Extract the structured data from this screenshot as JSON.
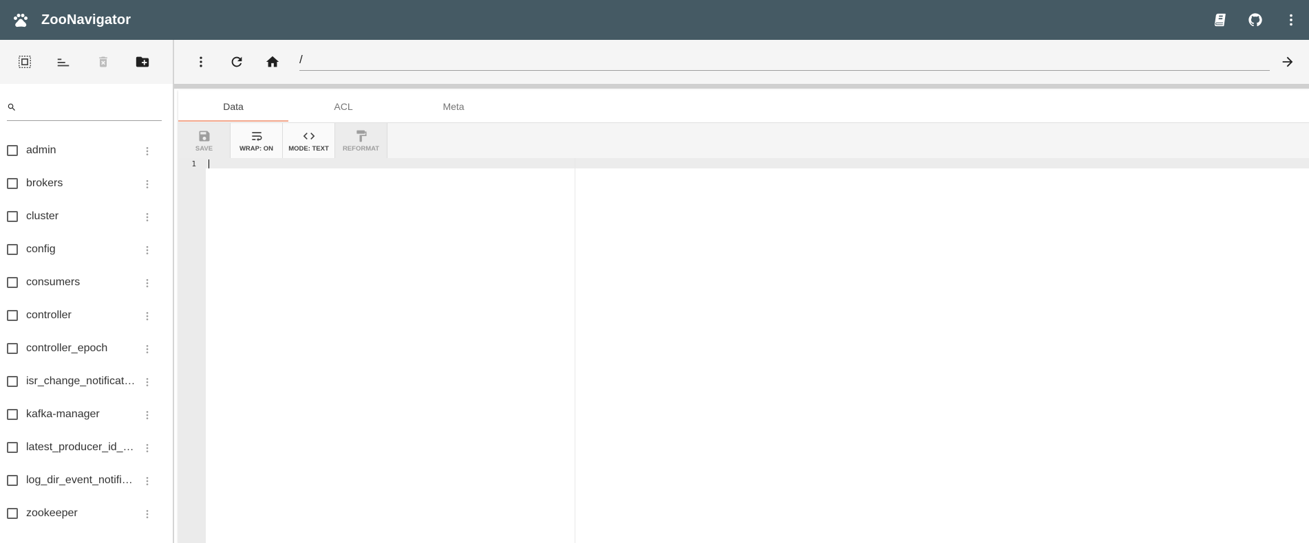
{
  "header": {
    "app_title": "ZooNavigator",
    "icons": [
      "paw-icon",
      "book-icon",
      "github-icon",
      "more-vert-icon"
    ],
    "color": "#455a64"
  },
  "left_toolbar": {
    "icons": [
      "select-all-icon",
      "sort-icon",
      "delete-icon",
      "create-folder-icon"
    ]
  },
  "path_bar": {
    "icons": [
      "more-vert-icon",
      "refresh-icon",
      "home-icon",
      "arrow-forward-icon"
    ],
    "path_value": "/"
  },
  "search": {
    "icon": "search-icon",
    "value": ""
  },
  "nodes": [
    {
      "label": "admin"
    },
    {
      "label": "brokers"
    },
    {
      "label": "cluster"
    },
    {
      "label": "config"
    },
    {
      "label": "consumers"
    },
    {
      "label": "controller"
    },
    {
      "label": "controller_epoch"
    },
    {
      "label": "isr_change_notification"
    },
    {
      "label": "kafka-manager"
    },
    {
      "label": "latest_producer_id_block"
    },
    {
      "label": "log_dir_event_notification"
    },
    {
      "label": "zookeeper"
    }
  ],
  "tabs": [
    {
      "label": "Data",
      "active": true
    },
    {
      "label": "ACL",
      "active": false
    },
    {
      "label": "Meta",
      "active": false
    }
  ],
  "editor_toolbar": [
    {
      "label": "SAVE",
      "icon": "save-icon",
      "disabled": true
    },
    {
      "label": "WRAP: ON",
      "icon": "wrap-icon",
      "disabled": false
    },
    {
      "label": "MODE: TEXT",
      "icon": "code-icon",
      "disabled": false
    },
    {
      "label": "REFORMAT",
      "icon": "format-paint-icon",
      "disabled": true
    }
  ],
  "editor": {
    "line_numbers": [
      "1"
    ],
    "content": ""
  },
  "colors": {
    "tab_ink": "#f0a58a",
    "toolbar_bg": "#f5f5f5"
  }
}
